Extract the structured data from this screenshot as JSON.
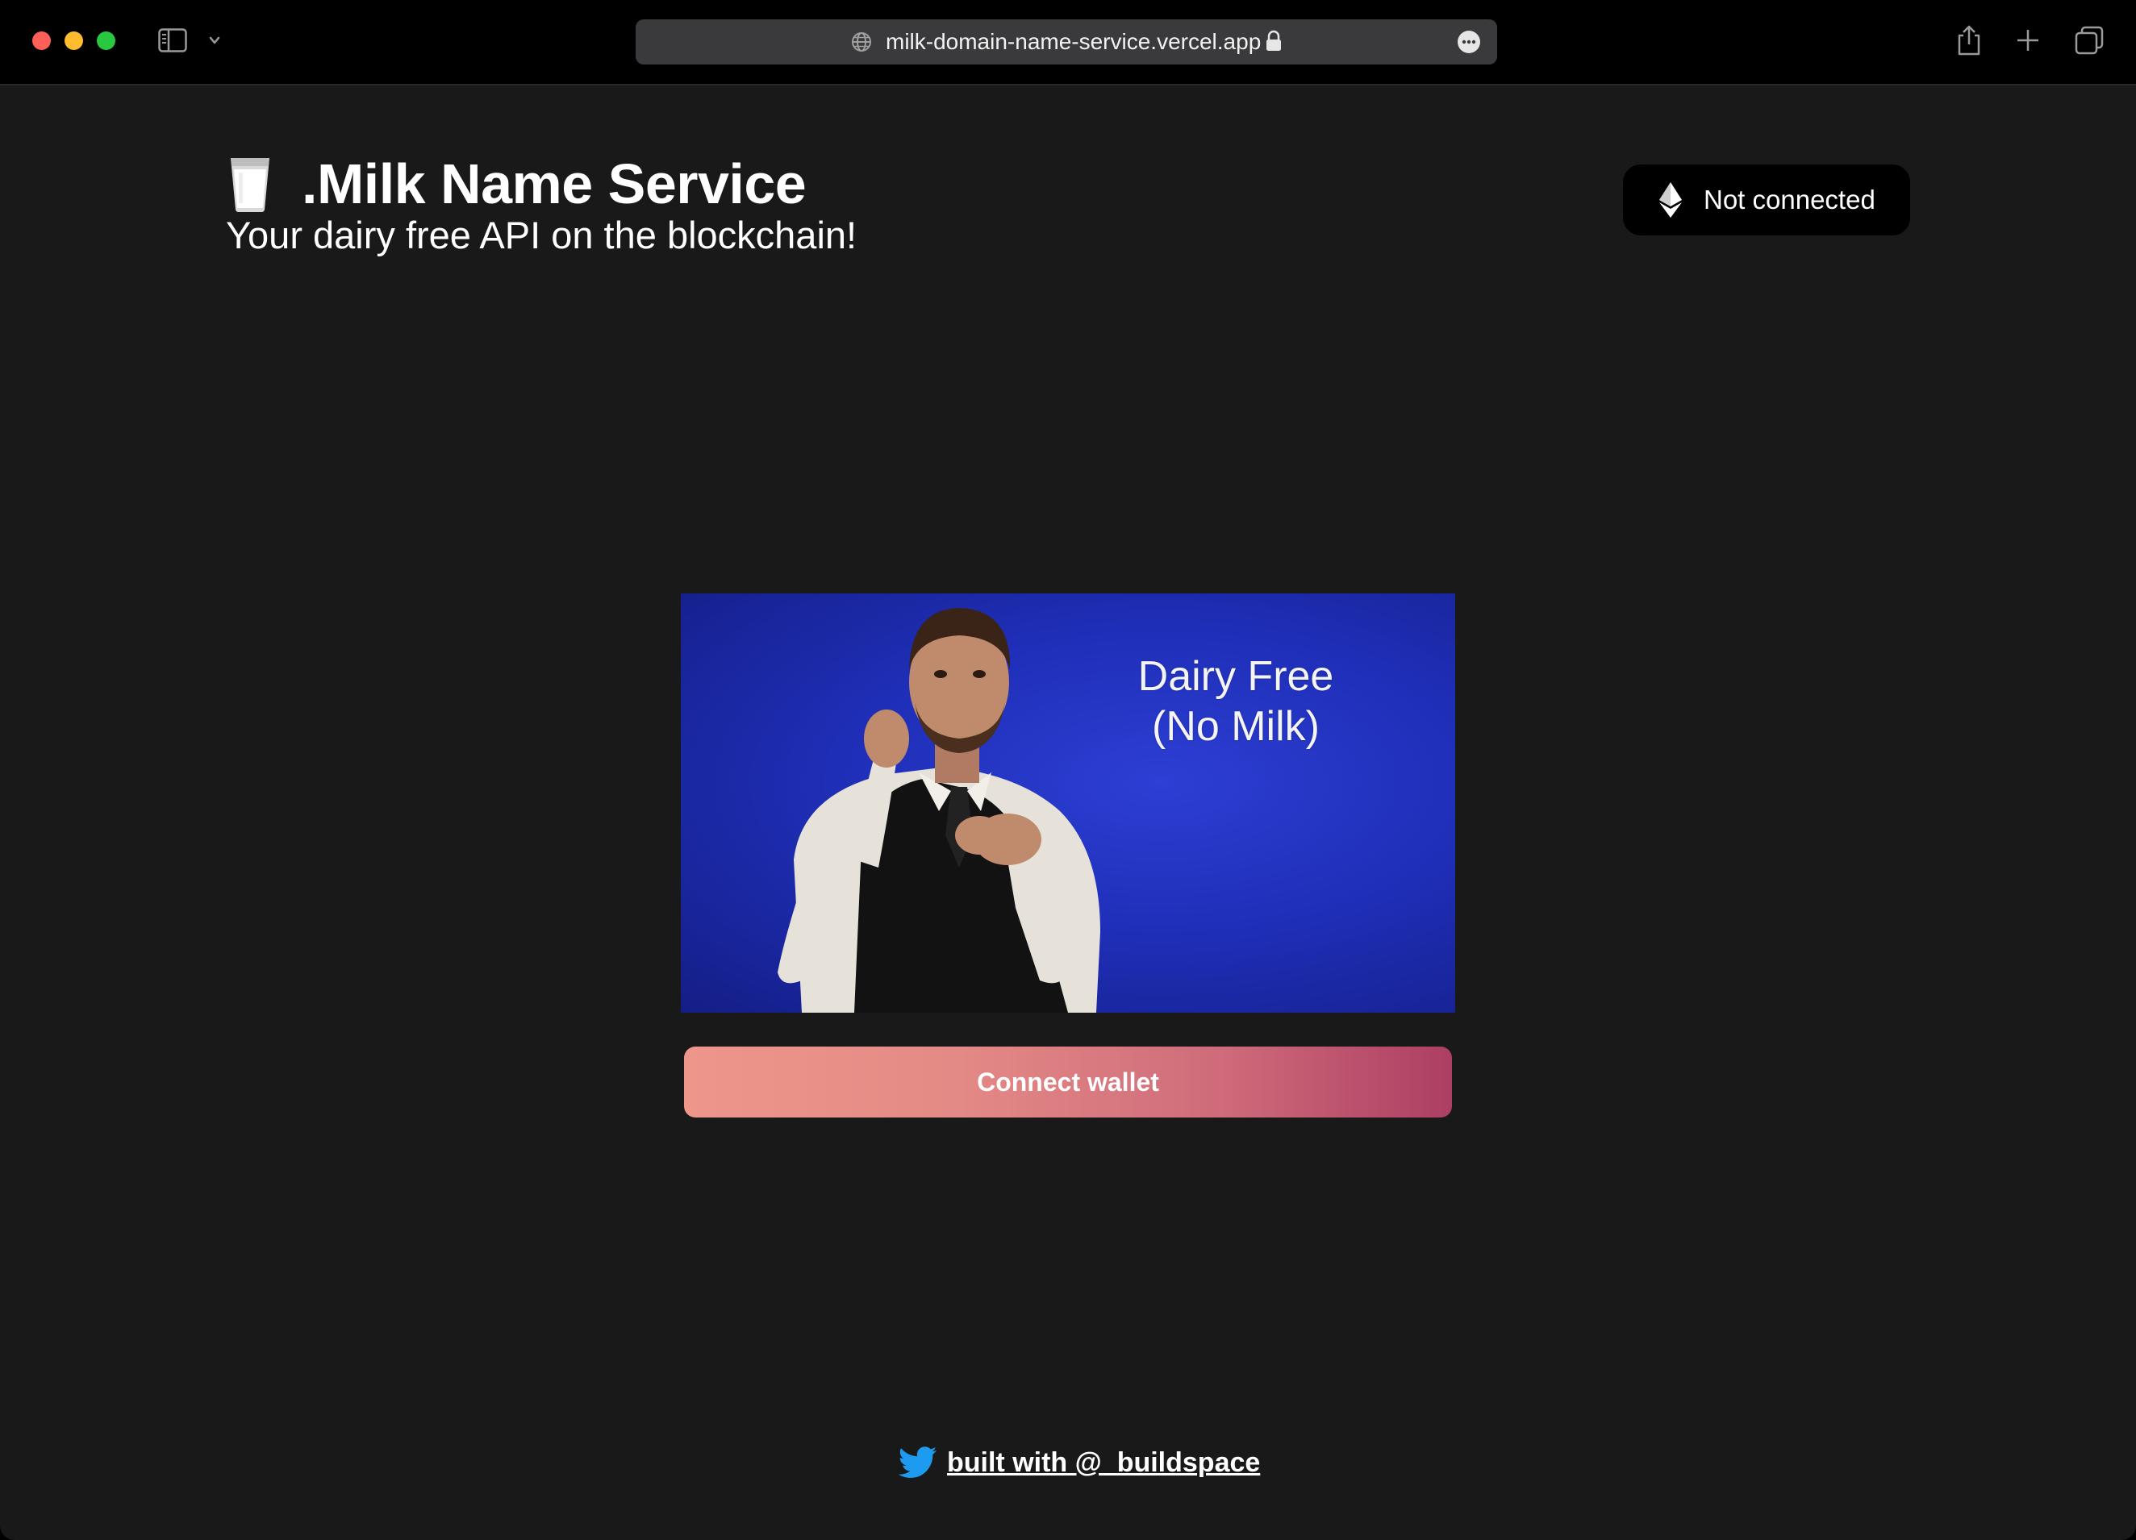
{
  "browser": {
    "url": "milk-domain-name-service.vercel.app"
  },
  "header": {
    "title": ".Milk Name Service",
    "subtitle": "Your dairy free API on the blockchain!",
    "wallet_status": "Not connected"
  },
  "gif": {
    "caption_line1": "Dairy Free",
    "caption_line2": "(No Milk)"
  },
  "actions": {
    "connect_label": "Connect wallet"
  },
  "footer": {
    "link_text": "built with @_buildspace"
  },
  "colors": {
    "page_background": "#191919",
    "button_gradient_start": "#ee968a",
    "button_gradient_end": "#ac3f63",
    "gif_background": "#1f2fb9"
  }
}
